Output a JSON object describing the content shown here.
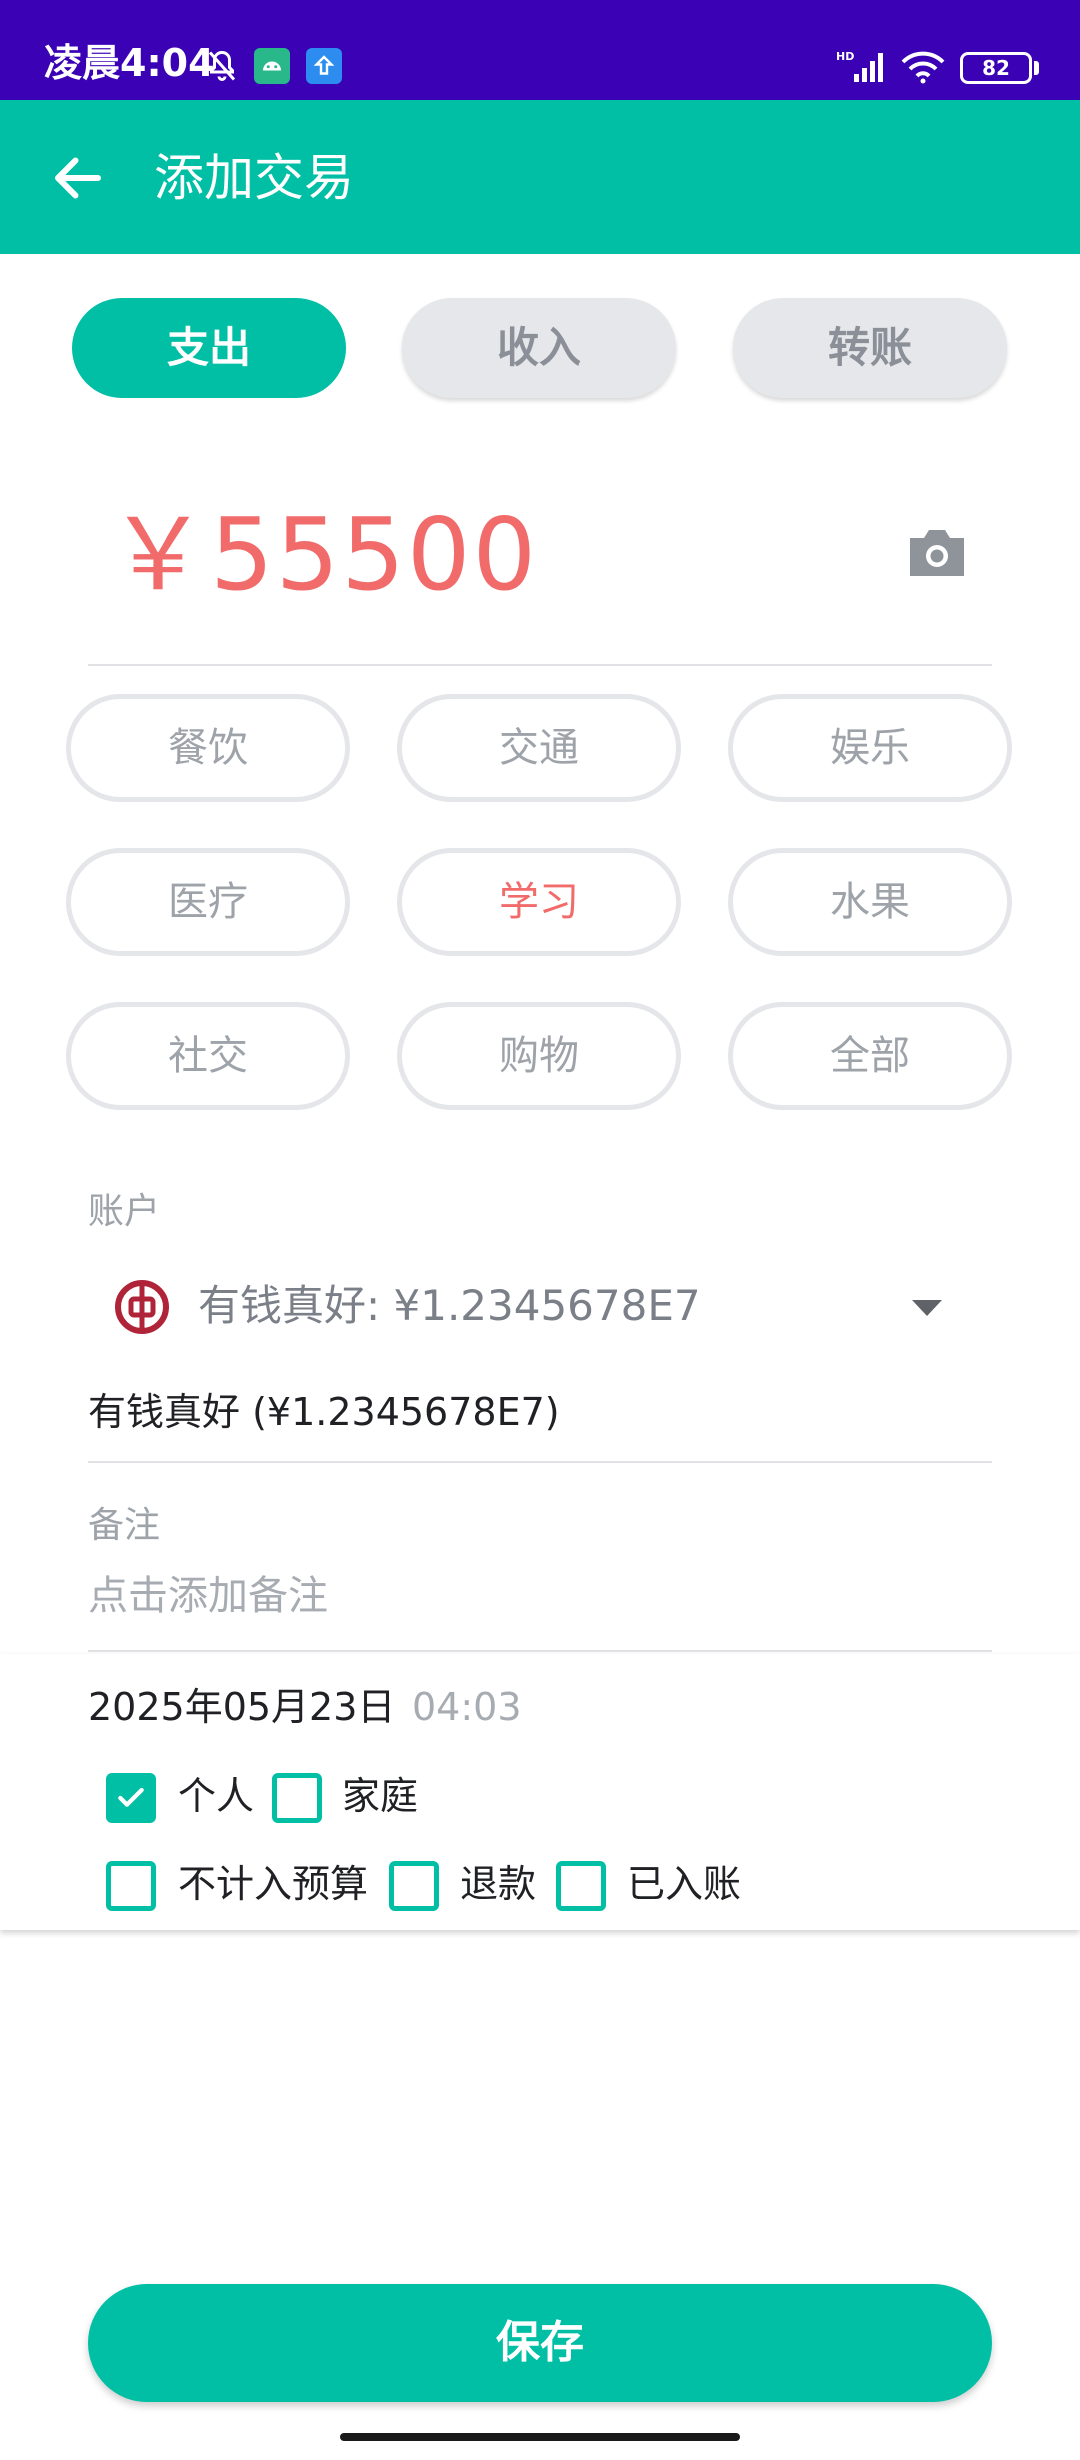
{
  "status_bar": {
    "time": "凌晨4:04",
    "battery": "82",
    "icons": [
      "bell-off-icon",
      "android-icon",
      "upload-icon",
      "signal-icon",
      "wifi-icon",
      "battery-icon"
    ]
  },
  "toolbar": {
    "title": "添加交易",
    "back_icon": "arrow-left-icon"
  },
  "type_tabs": [
    {
      "label": "支出",
      "active": true
    },
    {
      "label": "收入",
      "active": false
    },
    {
      "label": "转账",
      "active": false
    }
  ],
  "amount": {
    "value": "￥55500",
    "icon": "camera-icon"
  },
  "categories": [
    {
      "label": "餐饮",
      "selected": false
    },
    {
      "label": "交通",
      "selected": false
    },
    {
      "label": "娱乐",
      "selected": false
    },
    {
      "label": "医疗",
      "selected": false
    },
    {
      "label": "学习",
      "selected": true
    },
    {
      "label": "水果",
      "selected": false
    },
    {
      "label": "社交",
      "selected": false
    },
    {
      "label": "购物",
      "selected": false
    },
    {
      "label": "全部",
      "selected": false
    }
  ],
  "account": {
    "label": "账户",
    "selected_option": "有钱真好: ¥1.2345678E7",
    "current": "有钱真好 (¥1.2345678E7)"
  },
  "note": {
    "label": "备注",
    "placeholder": "点击添加备注"
  },
  "datetime": {
    "date": "2025年05月23日",
    "time": "04:03"
  },
  "checkboxes": [
    {
      "label": "个人",
      "checked": true
    },
    {
      "label": "家庭",
      "checked": false
    },
    {
      "label": "不计入预算",
      "checked": false
    },
    {
      "label": "退款",
      "checked": false
    },
    {
      "label": "已入账",
      "checked": false
    }
  ],
  "save_button": {
    "label": "保存"
  },
  "colors": {
    "accent": "#00bfa5",
    "status_bar": "#3a01b5",
    "amount": "#f26b6b"
  }
}
